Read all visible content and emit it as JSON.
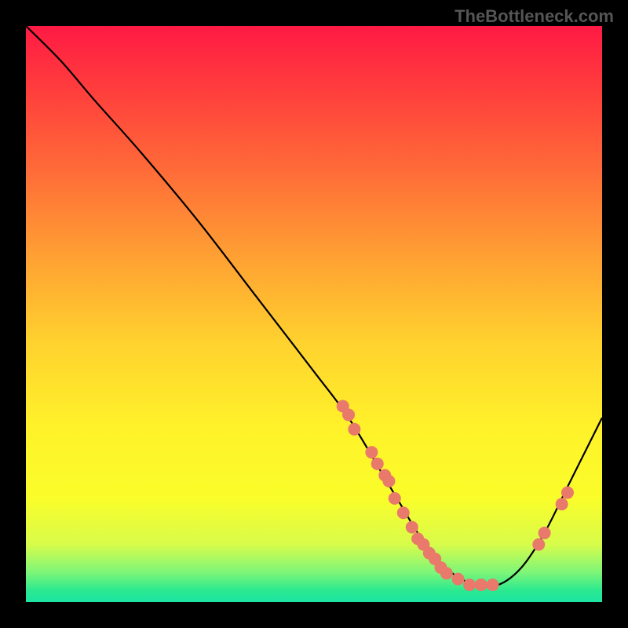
{
  "watermark": "TheBottleneck.com",
  "chart_data": {
    "type": "line",
    "title": "",
    "xlabel": "",
    "ylabel": "",
    "xlim": [
      0,
      100
    ],
    "ylim": [
      0,
      100
    ],
    "series": [
      {
        "name": "curve",
        "x": [
          0,
          6,
          12,
          20,
          30,
          40,
          50,
          56,
          62,
          65,
          68,
          71,
          74,
          78,
          82,
          86,
          90,
          94,
          98,
          100
        ],
        "y": [
          100,
          94,
          87,
          78,
          66,
          53,
          40,
          32,
          22,
          17,
          12,
          8,
          5,
          3,
          3,
          6,
          12,
          20,
          28,
          32
        ]
      }
    ],
    "points": [
      {
        "x": 55,
        "y": 34
      },
      {
        "x": 56,
        "y": 32.5
      },
      {
        "x": 57,
        "y": 30
      },
      {
        "x": 60,
        "y": 26
      },
      {
        "x": 61,
        "y": 24
      },
      {
        "x": 62.3,
        "y": 22
      },
      {
        "x": 63,
        "y": 21
      },
      {
        "x": 64,
        "y": 18
      },
      {
        "x": 65.5,
        "y": 15.5
      },
      {
        "x": 67,
        "y": 13
      },
      {
        "x": 68,
        "y": 11
      },
      {
        "x": 69,
        "y": 10
      },
      {
        "x": 70,
        "y": 8.5
      },
      {
        "x": 71,
        "y": 7.5
      },
      {
        "x": 72,
        "y": 6
      },
      {
        "x": 73,
        "y": 5
      },
      {
        "x": 75,
        "y": 4
      },
      {
        "x": 77,
        "y": 3
      },
      {
        "x": 79,
        "y": 3
      },
      {
        "x": 81,
        "y": 3
      },
      {
        "x": 89,
        "y": 10
      },
      {
        "x": 90,
        "y": 12
      },
      {
        "x": 93,
        "y": 17
      },
      {
        "x": 94,
        "y": 19
      }
    ],
    "point_color": "#e8796b",
    "point_radius": 8
  }
}
